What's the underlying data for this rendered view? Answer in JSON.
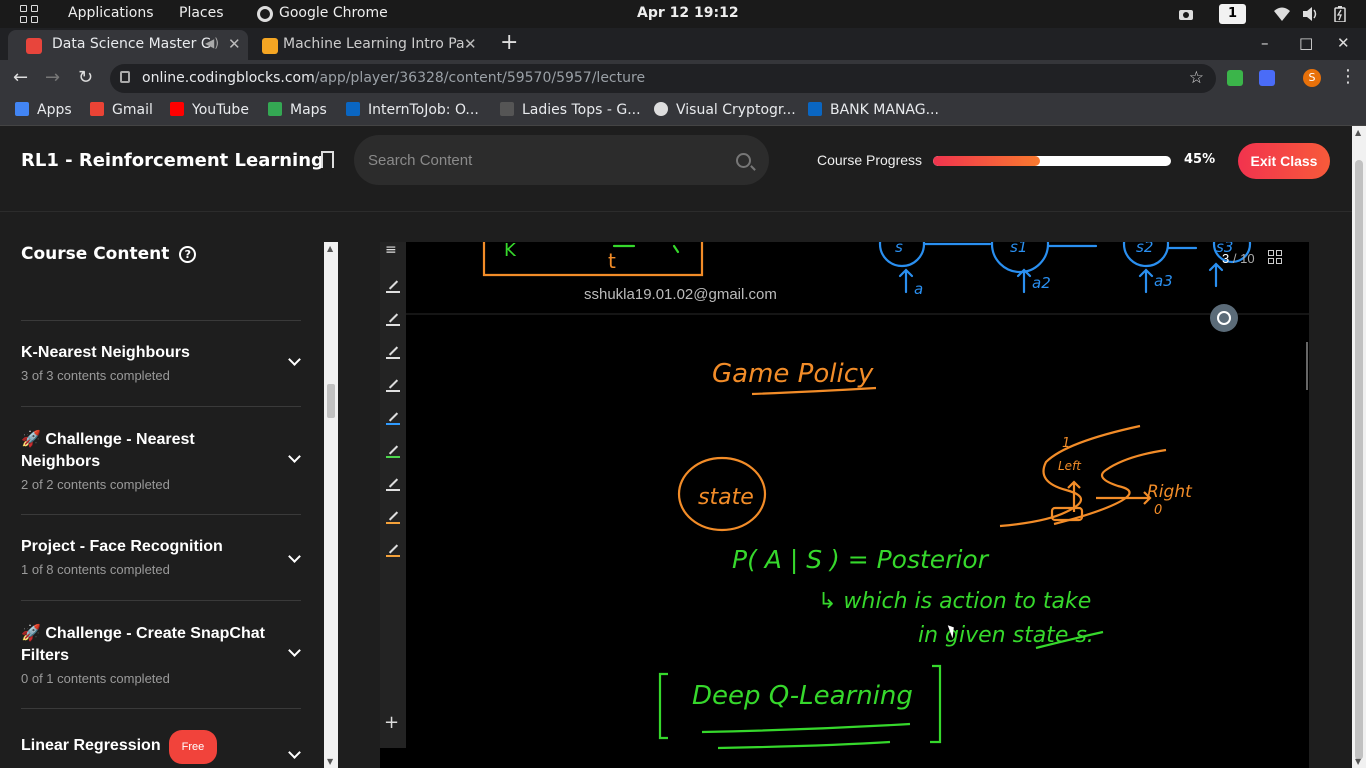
{
  "os_bar": {
    "applications": "Applications",
    "places": "Places",
    "active_app": "Google Chrome",
    "clock": "Apr 12  19:12",
    "workspace": "1"
  },
  "tabs": [
    {
      "label": "Data Science Master C",
      "active": true,
      "favicon_color": "#e8453c"
    },
    {
      "label": "Machine Learning Intro Pa",
      "active": false,
      "favicon_color": "#f5a623"
    }
  ],
  "address": {
    "domain": "online.codingblocks.com",
    "path": "/app/player/36328/content/59570/5957/lecture"
  },
  "bookmarks": [
    {
      "label": "Apps",
      "icon": "apps-grid-icon",
      "color": "#4285f4"
    },
    {
      "label": "Gmail",
      "icon": "gmail-icon",
      "color": "#ea4335"
    },
    {
      "label": "YouTube",
      "icon": "youtube-icon",
      "color": "#ff0000"
    },
    {
      "label": "Maps",
      "icon": "maps-icon",
      "color": "#34a853"
    },
    {
      "label": "InternToJob: O...",
      "icon": "linkedin-icon",
      "color": "#0a66c2"
    },
    {
      "label": "Ladies Tops - G...",
      "icon": "generic-icon",
      "color": "#555555"
    },
    {
      "label": "Visual Cryptogr...",
      "icon": "github-icon",
      "color": "#dddddd"
    },
    {
      "label": "BANK MANAG...",
      "icon": "linkedin-icon",
      "color": "#0a66c2"
    }
  ],
  "header": {
    "course_title": "RL1 - Reinforcement Learning",
    "search_placeholder": "Search Content",
    "progress_label": "Course Progress",
    "progress_value": 0.45,
    "progress_text": "45%",
    "exit_label": "Exit Class"
  },
  "sidebar": {
    "title": "Course Content",
    "sections": [
      {
        "title": "K-Nearest Neighbours",
        "subtitle": "3 of 3 contents completed"
      },
      {
        "title": "🚀 Challenge - Nearest Neighbors",
        "subtitle": "2 of 2 contents completed"
      },
      {
        "title": "Project - Face Recognition",
        "subtitle": "1 of 8 contents completed"
      },
      {
        "title": "🚀 Challenge - Create SnapChat Filters",
        "subtitle": "0 of 1 contents completed"
      },
      {
        "title": "Linear Regression",
        "subtitle": "",
        "badge": "Free"
      }
    ]
  },
  "player": {
    "watermark": "sshukla19.01.02@gmail.com",
    "page_current": "3",
    "page_total": "/ 10",
    "pen_colors": [
      "#e0e0e0",
      "#e0e0e0",
      "#e0e0e0",
      "#e0e0e0",
      "#2f9bff",
      "#4dd64d",
      "#e0e0e0",
      "#f4a13a",
      "#f4a13a"
    ],
    "board": {
      "heading": "Game Policy",
      "state_label": "state",
      "equation": "P( A | S )  =  Posterior",
      "explanation_1": "↳ which is action to take",
      "explanation_2": "in given state s.",
      "left_label": "Left",
      "right_label": "Right",
      "up_label": "1",
      "zero_label": "0",
      "bottom_label": "Deep Q-Learning",
      "top_letters": [
        "s",
        "s1",
        "s2",
        "s3"
      ],
      "top_actions": [
        "a",
        "a2",
        "a3"
      ],
      "top_box_letter": "t",
      "ink_orange": "#f28c28",
      "ink_blue": "#2a8ff0",
      "ink_green": "#36d82c"
    }
  }
}
